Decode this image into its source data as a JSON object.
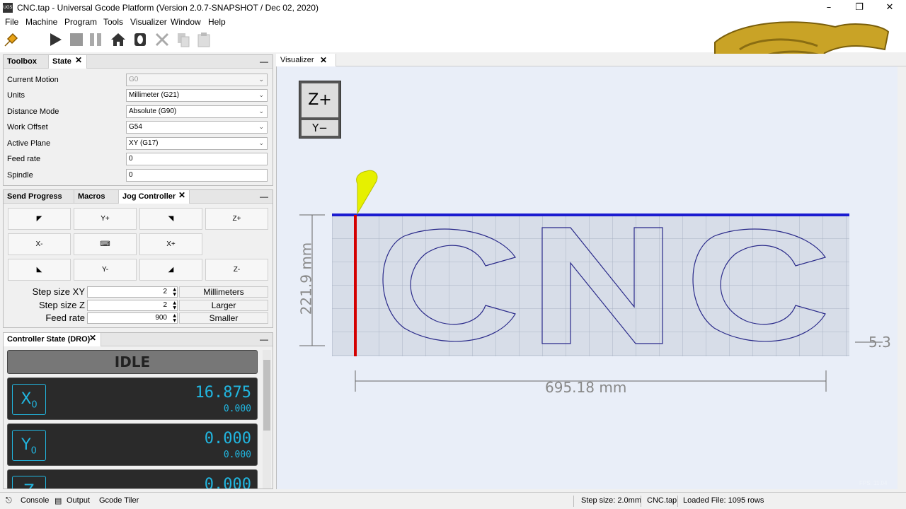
{
  "window": {
    "title": "CNC.tap - Universal Gcode Platform (Version 2.0.7-SNAPSHOT / Dec 02, 2020)",
    "icon": "UGS",
    "minimize": "–",
    "restore": "❐",
    "close": "✕"
  },
  "menu": [
    "File",
    "Machine",
    "Program",
    "Tools",
    "Visualizer",
    "Window",
    "Help"
  ],
  "state_panel": {
    "tabs": [
      "Toolbox",
      "State"
    ],
    "rows": [
      {
        "label": "Current Motion",
        "value": "G0"
      },
      {
        "label": "Units",
        "value": "Millimeter (G21)"
      },
      {
        "label": "Distance Mode",
        "value": "Absolute (G90)"
      },
      {
        "label": "Work Offset",
        "value": "G54"
      },
      {
        "label": "Active Plane",
        "value": "XY (G17)"
      },
      {
        "label": "Feed rate",
        "value": "0"
      },
      {
        "label": "Spindle",
        "value": "0"
      }
    ]
  },
  "jog_panel": {
    "tabs": [
      "Send Progress",
      "Macros",
      "Jog Controller"
    ],
    "buttons": {
      "y_plus": "Y+",
      "z_plus": "Z+",
      "x_minus": "X-",
      "x_plus": "X+",
      "y_minus": "Y-",
      "z_minus": "Z-"
    },
    "step_xy_label": "Step size XY",
    "step_xy": "2",
    "step_z_label": "Step size Z",
    "step_z": "2",
    "feed_label": "Feed rate",
    "feed": "900",
    "units_btn": "Millimeters",
    "larger_btn": "Larger",
    "smaller_btn": "Smaller"
  },
  "dro_panel": {
    "tab": "Controller State (DRO)",
    "state": "IDLE",
    "x": {
      "axis": "X",
      "sub": "0",
      "work": "16.875",
      "machine": "0.000"
    },
    "y": {
      "axis": "Y",
      "sub": "0",
      "work": "0.000",
      "machine": "0.000"
    },
    "z": {
      "axis": "Z",
      "work": "0.000"
    }
  },
  "visualizer": {
    "tab": "Visualizer",
    "view_top": "Z+",
    "view_bottom": "Y−",
    "width_dim": "695.18 mm",
    "height_dim": "221.9 mm",
    "depth_dim": "5.3",
    "fps": "FPS: 11.04"
  },
  "status": {
    "console": "Console",
    "output": "Output",
    "tiler": "Gcode Tiler",
    "step": "Step size: 2.0mm",
    "file": "CNC.tap",
    "loaded": "Loaded File: 1095 rows"
  }
}
